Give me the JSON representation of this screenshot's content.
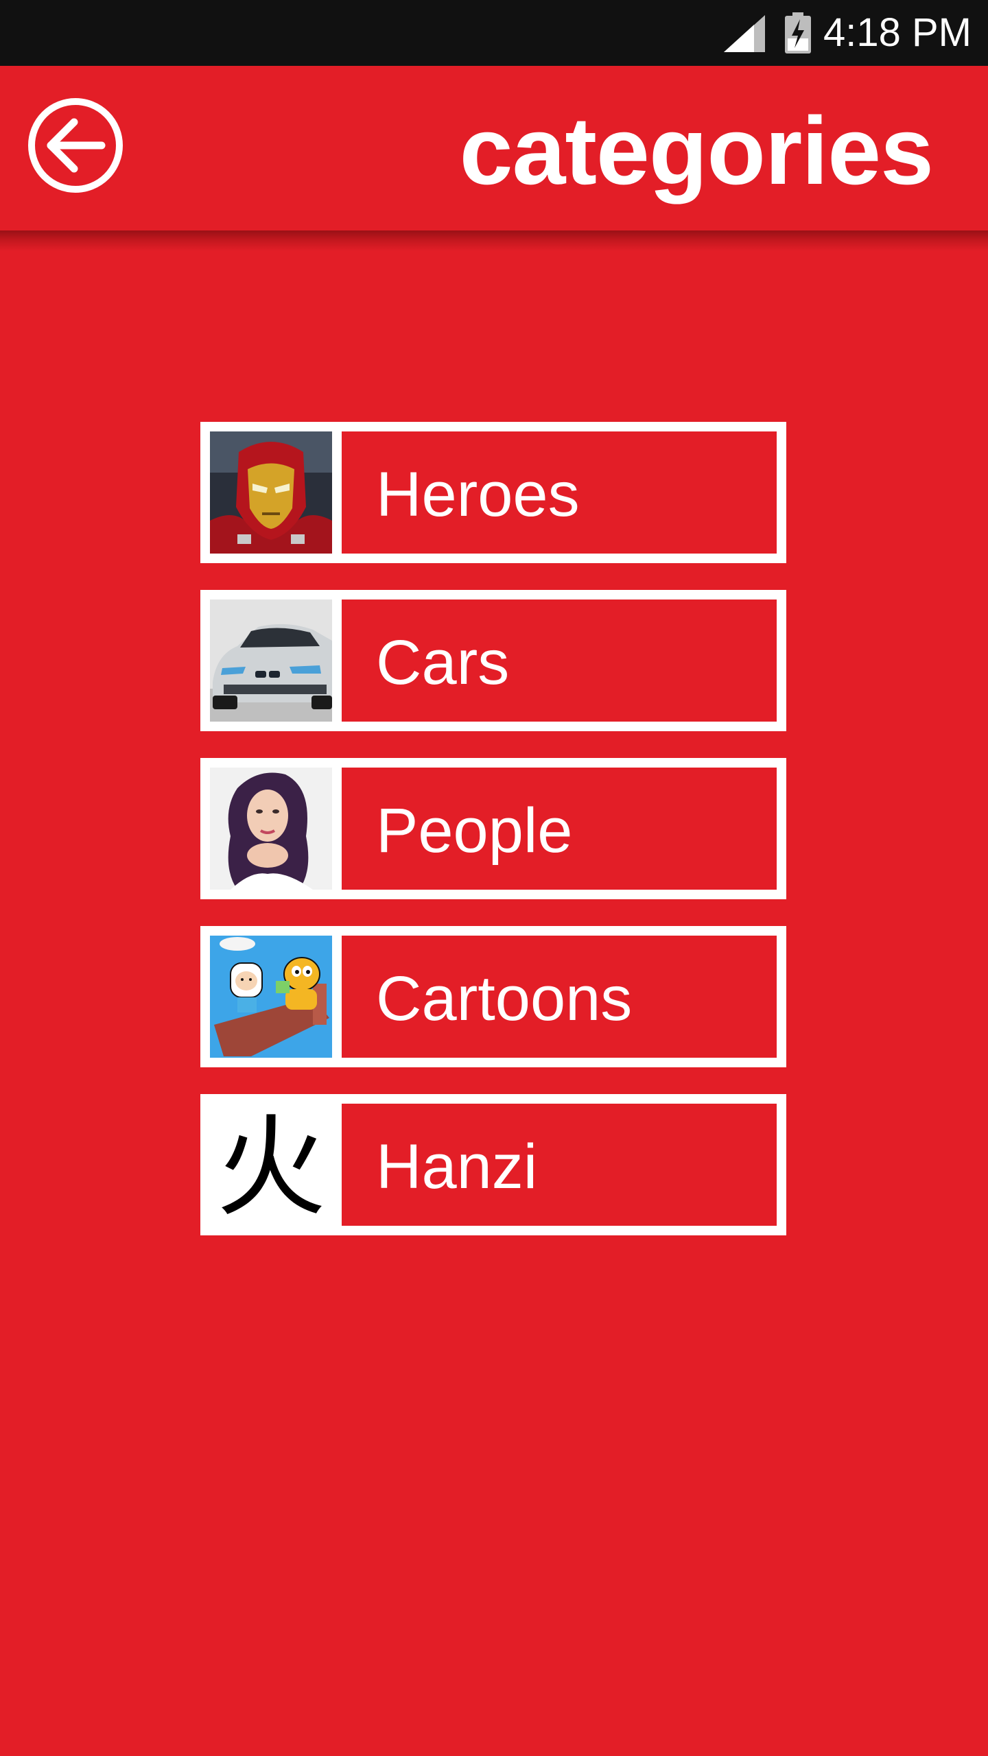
{
  "status_bar": {
    "time": "4:18 PM",
    "icons": [
      "signal-icon",
      "battery-charging-icon"
    ]
  },
  "app_bar": {
    "back_icon": "back-arrow-icon",
    "title": "categories"
  },
  "colors": {
    "primary": "#e31e27",
    "status_bar": "#111111",
    "text": "#ffffff"
  },
  "categories": [
    {
      "label": "Heroes",
      "image": "iron-man-thumbnail"
    },
    {
      "label": "Cars",
      "image": "silver-car-thumbnail"
    },
    {
      "label": "People",
      "image": "woman-portrait-thumbnail"
    },
    {
      "label": "Cartoons",
      "image": "cartoon-characters-thumbnail"
    },
    {
      "label": "Hanzi",
      "image": "chinese-character-thumbnail",
      "glyph": "火"
    }
  ]
}
